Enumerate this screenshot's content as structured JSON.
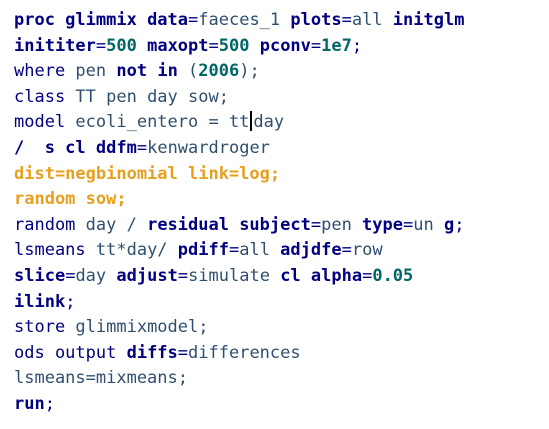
{
  "code_lines": [
    [
      {
        "t": "proc glimmix",
        "c": "kw"
      },
      {
        "t": " data",
        "c": "kw"
      },
      {
        "t": "=",
        "c": "kwn"
      },
      {
        "t": "faeces_1",
        "c": "pl"
      },
      {
        "t": " plots",
        "c": "kw"
      },
      {
        "t": "=",
        "c": "kwn"
      },
      {
        "t": "all",
        "c": "pl"
      },
      {
        "t": " initglm",
        "c": "kw"
      }
    ],
    [
      {
        "t": "inititer",
        "c": "kw"
      },
      {
        "t": "=",
        "c": "kwn"
      },
      {
        "t": "500",
        "c": "nm"
      },
      {
        "t": " maxopt",
        "c": "kw"
      },
      {
        "t": "=",
        "c": "kwn"
      },
      {
        "t": "500",
        "c": "nm"
      },
      {
        "t": " pconv",
        "c": "kw"
      },
      {
        "t": "=",
        "c": "kwn"
      },
      {
        "t": "1e7",
        "c": "nm"
      },
      {
        "t": ";",
        "c": "kwn"
      }
    ],
    [
      {
        "t": "where",
        "c": "kwn"
      },
      {
        "t": " pen ",
        "c": "pl"
      },
      {
        "t": "not",
        "c": "kw"
      },
      {
        "t": " in ",
        "c": "kw"
      },
      {
        "t": "(",
        "c": "pl"
      },
      {
        "t": "2006",
        "c": "nm"
      },
      {
        "t": ");",
        "c": "pl"
      }
    ],
    [
      {
        "t": "class",
        "c": "kwn"
      },
      {
        "t": " TT pen day sow;",
        "c": "pl"
      }
    ],
    [
      {
        "t": "model",
        "c": "kwn"
      },
      {
        "t": " ecoli_entero = tt",
        "c": "pl"
      },
      {
        "t": "",
        "c": "caret"
      },
      {
        "t": "day",
        "c": "pl"
      }
    ],
    [
      {
        "t": "/  s cl ",
        "c": "kw"
      },
      {
        "t": "ddfm",
        "c": "kw"
      },
      {
        "t": "=",
        "c": "kwn"
      },
      {
        "t": "kenwardroger",
        "c": "pl"
      }
    ],
    [
      {
        "t": "dist=negbinomial link=log;",
        "c": "hl"
      }
    ],
    [
      {
        "t": "random sow;",
        "c": "hl"
      }
    ],
    [
      {
        "t": "random",
        "c": "kwn"
      },
      {
        "t": " day / ",
        "c": "pl"
      },
      {
        "t": "residual subject",
        "c": "kw"
      },
      {
        "t": "=",
        "c": "kwn"
      },
      {
        "t": "pen ",
        "c": "pl"
      },
      {
        "t": "type",
        "c": "kw"
      },
      {
        "t": "=",
        "c": "kwn"
      },
      {
        "t": "un ",
        "c": "pl"
      },
      {
        "t": "g",
        "c": "kw"
      },
      {
        "t": ";",
        "c": "kwn"
      }
    ],
    [
      {
        "t": "lsmeans",
        "c": "kwn"
      },
      {
        "t": " tt*day/ ",
        "c": "pl"
      },
      {
        "t": "pdiff",
        "c": "kw"
      },
      {
        "t": "=",
        "c": "kwn"
      },
      {
        "t": "all ",
        "c": "pl"
      },
      {
        "t": "adjdfe",
        "c": "kw"
      },
      {
        "t": "=",
        "c": "kwn"
      },
      {
        "t": "row",
        "c": "pl"
      }
    ],
    [
      {
        "t": "slice",
        "c": "kw"
      },
      {
        "t": "=",
        "c": "kwn"
      },
      {
        "t": "day ",
        "c": "pl"
      },
      {
        "t": "adjust",
        "c": "kw"
      },
      {
        "t": "=",
        "c": "kwn"
      },
      {
        "t": "simulate ",
        "c": "pl"
      },
      {
        "t": "cl alpha",
        "c": "kw"
      },
      {
        "t": "=",
        "c": "kwn"
      },
      {
        "t": "0.05",
        "c": "nm"
      }
    ],
    [
      {
        "t": "ilink",
        "c": "kw"
      },
      {
        "t": ";",
        "c": "kwn"
      }
    ],
    [
      {
        "t": "store",
        "c": "kwn"
      },
      {
        "t": " glimmixmodel;",
        "c": "pl"
      }
    ],
    [
      {
        "t": "ods output",
        "c": "kwn"
      },
      {
        "t": " diffs",
        "c": "kw"
      },
      {
        "t": "=",
        "c": "kwn"
      },
      {
        "t": "differences",
        "c": "pl"
      }
    ],
    [
      {
        "t": "lsmeans=mixmeans;",
        "c": "pl"
      }
    ],
    [
      {
        "t": "run",
        "c": "kw"
      },
      {
        "t": ";",
        "c": "kwn"
      }
    ]
  ],
  "colors": {
    "keyword": "#000080",
    "plain": "#2f4f6f",
    "number": "#006666",
    "highlight": "#e6a020",
    "background": "#ffffff"
  }
}
